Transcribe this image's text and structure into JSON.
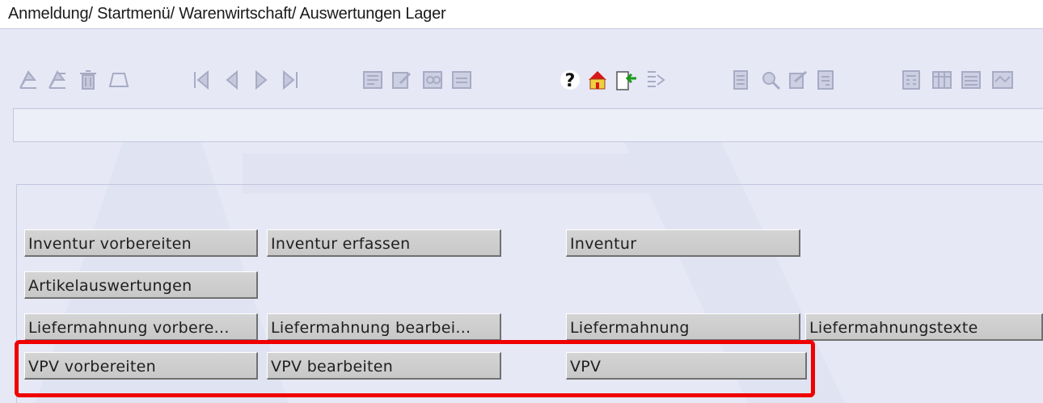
{
  "window": {
    "breadcrumb": "Anmeldung/ Startmenü/ Warenwirtschaft/ Auswertungen Lager"
  },
  "toolbar": {
    "icons": [
      "new-record-icon",
      "copy-record-icon",
      "delete-record-icon",
      "clear-icon",
      "first-record-icon",
      "previous-record-icon",
      "next-record-icon",
      "last-record-icon",
      "select-icon",
      "edit-icon",
      "search-icon",
      "print-preview-icon",
      "help-icon",
      "home-icon",
      "exit-icon",
      "export-icon",
      "document-icon",
      "zoom-icon",
      "check-icon",
      "notes-icon",
      "calculator-icon",
      "table-icon",
      "list-icon",
      "report-icon"
    ]
  },
  "buttons": {
    "inventur_vorbereiten": "Inventur vorbereiten",
    "inventur_erfassen": "Inventur erfassen",
    "inventur": "Inventur",
    "artikelauswertungen": "Artikelauswertungen",
    "liefermahnung_vorbereiten": "Liefermahnung vorbere...",
    "liefermahnung_bearbeiten": "Liefermahnung bearbei...",
    "liefermahnung": "Liefermahnung",
    "liefermahnungstexte": "Liefermahnungstexte",
    "vpv_vorbereiten": "VPV vorbereiten",
    "vpv_bearbeiten": "VPV bearbeiten",
    "vpv": "VPV"
  },
  "colors": {
    "background": "#e6e8f6",
    "button_face": "#cccccc",
    "highlight": "#f00000",
    "icon_disabled": "#b8bad0",
    "icon_active_red": "#d81818",
    "icon_active_green": "#1a9a1a"
  }
}
